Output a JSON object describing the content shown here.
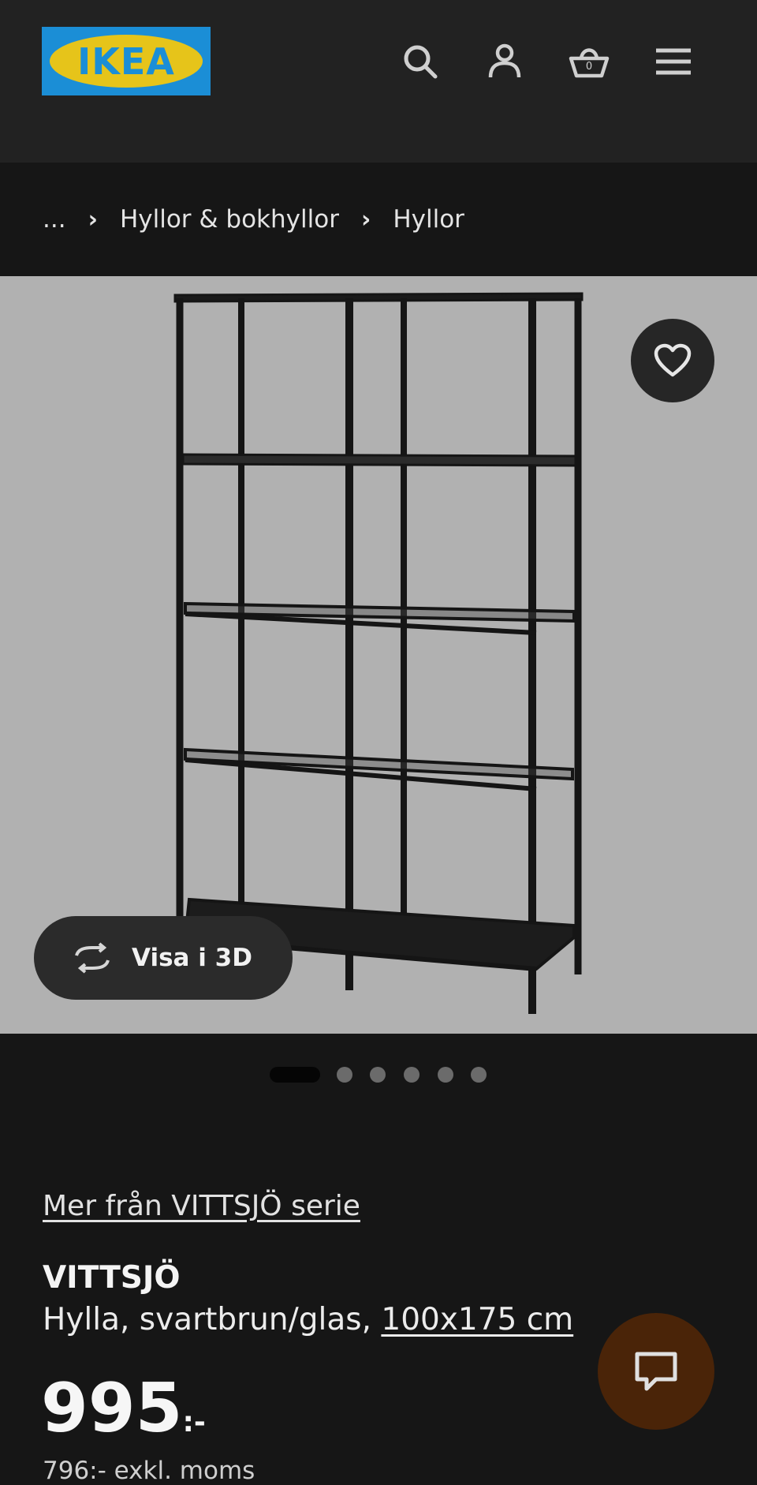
{
  "header": {
    "logo_text": "IKEA",
    "icons": [
      "search-icon",
      "user-icon",
      "shopping-basket-icon",
      "menu-icon"
    ]
  },
  "breadcrumb": {
    "items": [
      "...",
      "Hyllor & bokhyllor",
      "Hyllor"
    ],
    "separator": "›"
  },
  "gallery": {
    "view_3d_label": "Visa i 3D",
    "slide_count": 6,
    "active_slide": 1
  },
  "product": {
    "series_link": "Mer från VITTSJÖ serie",
    "name": "VITTSJÖ",
    "description": "Hylla, svartbrun/glas,",
    "dimensions": "100x175 cm",
    "price": "995",
    "price_suffix": ":-",
    "subtext": "796:- exkl. moms"
  },
  "colors": {
    "header_bg": "#222222",
    "page_bg": "#161616",
    "image_bg": "#b1b1b1",
    "logo_blue": "#1b8ed6",
    "logo_yellow": "#e6c41a",
    "chat_bg": "#4a2408"
  }
}
